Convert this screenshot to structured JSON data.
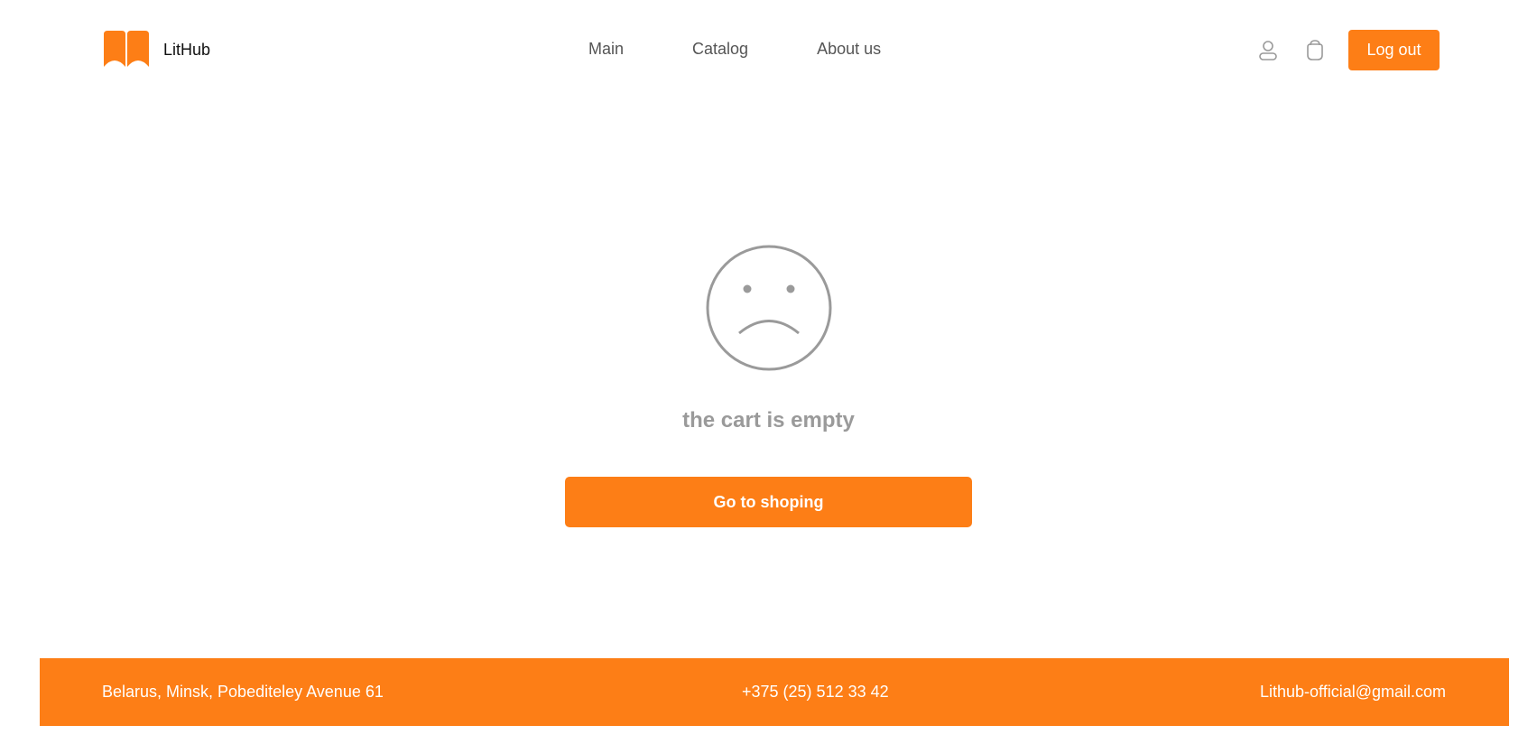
{
  "brand": {
    "name": "LitHub",
    "logo_icon": "book-icon",
    "accent_color": "#fd7e16"
  },
  "nav": {
    "items": [
      {
        "label": "Main"
      },
      {
        "label": "Catalog"
      },
      {
        "label": "About us"
      }
    ]
  },
  "header_actions": {
    "profile_icon": "user-icon",
    "cart_icon": "cart-icon",
    "logout_label": "Log out"
  },
  "cart": {
    "empty_icon": "sad-face-icon",
    "empty_message": "the cart is empty",
    "shop_button_label": "Go to shoping"
  },
  "footer": {
    "address": "Belarus, Minsk, Pobediteley Avenue 61",
    "phone": "+375 (25) 512 33 42",
    "email": "Lithub-official@gmail.com"
  }
}
